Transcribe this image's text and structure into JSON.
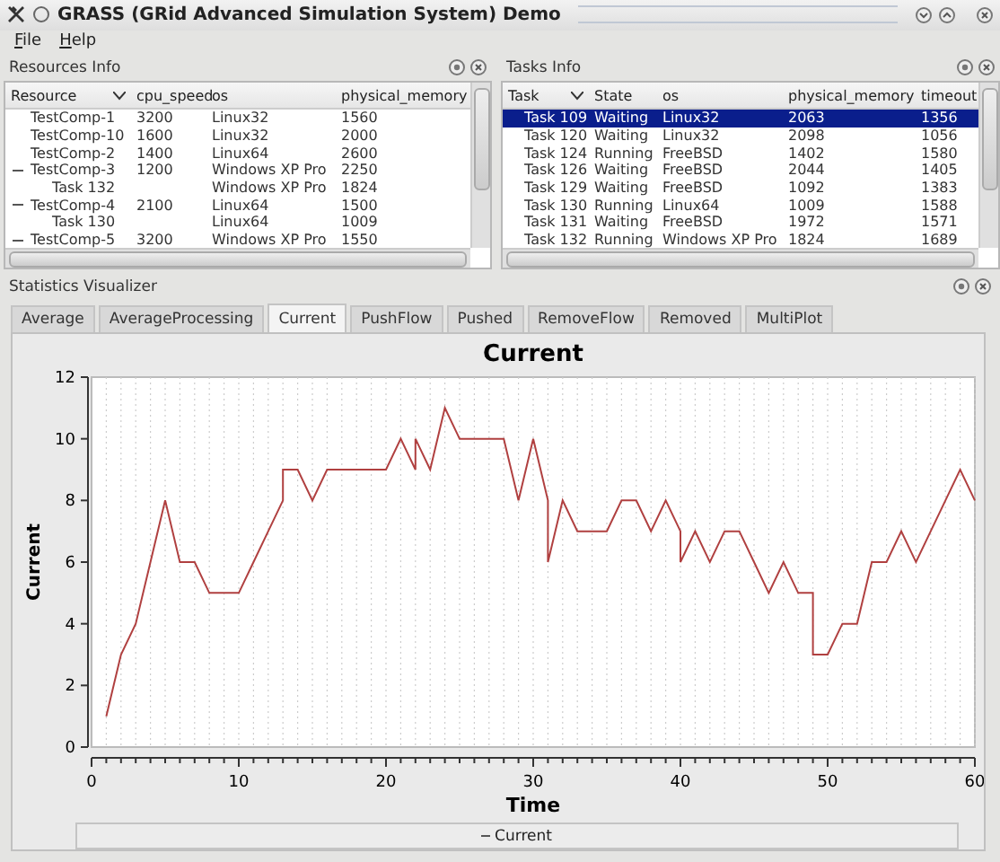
{
  "window": {
    "title": "GRASS (GRid Advanced Simulation System) Demo"
  },
  "menu": [
    {
      "label": "File"
    },
    {
      "label": "Help"
    }
  ],
  "resources_panel": {
    "title": "Resources Info",
    "columns": [
      "Resource",
      "cpu_speed",
      "os",
      "physical_memory"
    ],
    "rows": [
      {
        "cells": [
          "TestComp-1",
          "3200",
          "Linux32",
          "1560"
        ]
      },
      {
        "cells": [
          "TestComp-10",
          "1600",
          "Linux32",
          "2000"
        ]
      },
      {
        "cells": [
          "TestComp-2",
          "1400",
          "Linux64",
          "2600"
        ]
      },
      {
        "cells": [
          "TestComp-3",
          "1200",
          "Windows XP Pro",
          "2250"
        ],
        "expanded": true,
        "children": [
          {
            "cells": [
              "Task 132",
              "",
              "Windows XP Pro",
              "1824"
            ]
          }
        ]
      },
      {
        "cells": [
          "TestComp-4",
          "2100",
          "Linux64",
          "1500"
        ],
        "expanded": true,
        "children": [
          {
            "cells": [
              "Task 130",
              "",
              "Linux64",
              "1009"
            ]
          }
        ]
      },
      {
        "cells": [
          "TestComp-5",
          "3200",
          "Windows XP Pro",
          "1550"
        ],
        "expanded": true
      }
    ]
  },
  "tasks_panel": {
    "title": "Tasks Info",
    "columns": [
      "Task",
      "State",
      "os",
      "physical_memory",
      "timeout"
    ],
    "rows": [
      {
        "cells": [
          "Task 109",
          "Waiting",
          "Linux32",
          "2063",
          "1356"
        ],
        "selected": true
      },
      {
        "cells": [
          "Task 120",
          "Waiting",
          "Linux32",
          "2098",
          "1056"
        ],
        "selected": false
      },
      {
        "cells": [
          "Task 124",
          "Running",
          "FreeBSD",
          "1402",
          "1580"
        ],
        "selected": false
      },
      {
        "cells": [
          "Task 126",
          "Waiting",
          "FreeBSD",
          "2044",
          "1405"
        ],
        "selected": false
      },
      {
        "cells": [
          "Task 129",
          "Waiting",
          "FreeBSD",
          "1092",
          "1383"
        ],
        "selected": false
      },
      {
        "cells": [
          "Task 130",
          "Running",
          "Linux64",
          "1009",
          "1588"
        ],
        "selected": false
      },
      {
        "cells": [
          "Task 131",
          "Waiting",
          "FreeBSD",
          "1972",
          "1571"
        ],
        "selected": false
      },
      {
        "cells": [
          "Task 132",
          "Running",
          "Windows XP Pro",
          "1824",
          "1689"
        ],
        "selected": false
      }
    ]
  },
  "statistics_panel": {
    "title": "Statistics Visualizer",
    "tabs": [
      {
        "label": "Average",
        "selected": false
      },
      {
        "label": "AverageProcessing",
        "selected": false
      },
      {
        "label": "Current",
        "selected": true
      },
      {
        "label": "PushFlow",
        "selected": false
      },
      {
        "label": "Pushed",
        "selected": false
      },
      {
        "label": "RemoveFlow",
        "selected": false
      },
      {
        "label": "Removed",
        "selected": false
      },
      {
        "label": "MultiPlot",
        "selected": false
      }
    ],
    "chart_data": {
      "type": "line",
      "title": "Current",
      "xlabel": "Time",
      "ylabel": "Current",
      "x": [
        1,
        2,
        3,
        4,
        5,
        6,
        7,
        8,
        9,
        10,
        11,
        12,
        13,
        13,
        14,
        15,
        16,
        17,
        18,
        19,
        20,
        21,
        22,
        22,
        23,
        24,
        25,
        26,
        27,
        28,
        29,
        30,
        31,
        31,
        32,
        33,
        34,
        35,
        36,
        37,
        38,
        39,
        40,
        40,
        41,
        42,
        43,
        44,
        45,
        46,
        47,
        48,
        49,
        49,
        50,
        51,
        52,
        53,
        54,
        55,
        56,
        57,
        58,
        59,
        60
      ],
      "series": [
        {
          "name": "Current",
          "color": "#b04040",
          "values": [
            1,
            3,
            4,
            6,
            8,
            6,
            6,
            5,
            5,
            5,
            6,
            7,
            8,
            9,
            9,
            8,
            9,
            9,
            9,
            9,
            9,
            10,
            9,
            10,
            9,
            11,
            10,
            10,
            10,
            10,
            8,
            10,
            8,
            6,
            8,
            7,
            7,
            7,
            8,
            8,
            7,
            8,
            7,
            6,
            7,
            6,
            7,
            7,
            6,
            5,
            6,
            5,
            5,
            3,
            3,
            4,
            4,
            6,
            6,
            7,
            6,
            7,
            8,
            9,
            8
          ]
        }
      ],
      "xlim": [
        0,
        60
      ],
      "ylim": [
        0,
        12
      ],
      "xticks": [
        0,
        10,
        20,
        30,
        40,
        50,
        60
      ],
      "yticks": [
        0,
        2,
        4,
        6,
        8,
        10,
        12
      ],
      "grid": true
    }
  }
}
